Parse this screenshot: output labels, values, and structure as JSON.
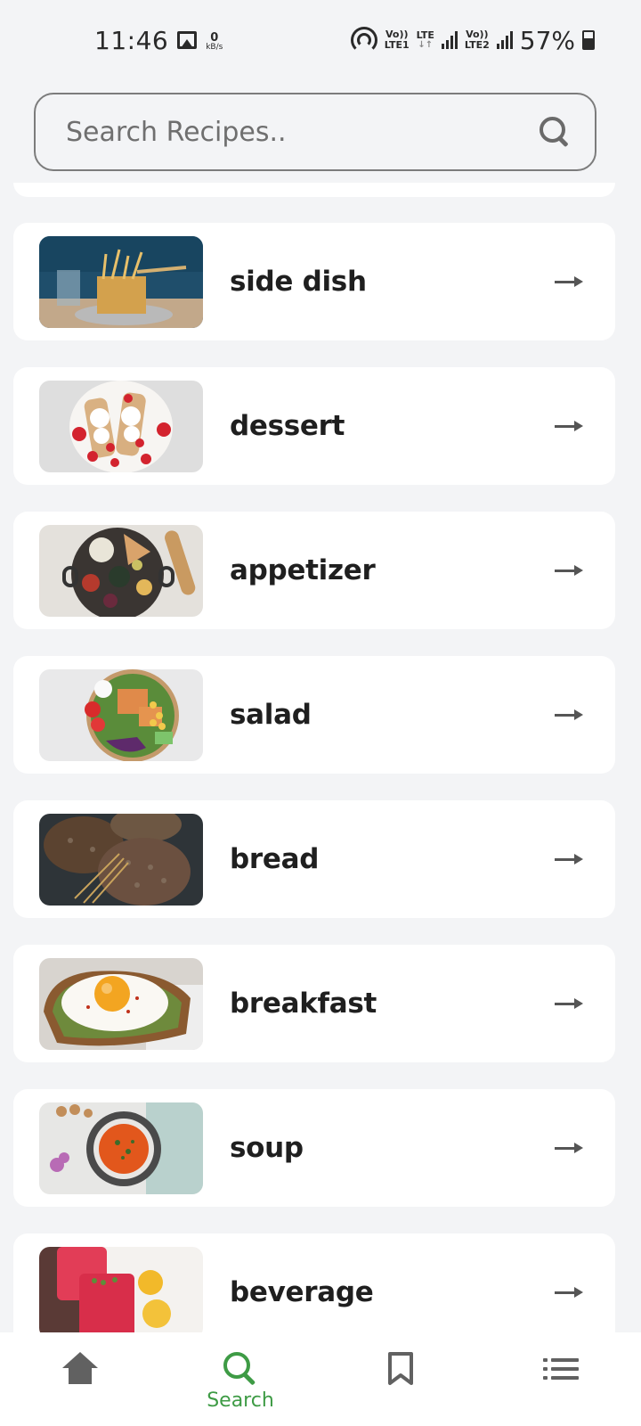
{
  "status_bar": {
    "time": "11:46",
    "speed_value": "0",
    "speed_unit": "kB/s",
    "net1_top": "Vo))",
    "net1_bottom": "LTE1",
    "net_lte": "LTE",
    "net2_top": "Vo))",
    "net2_bottom": "LTE2",
    "battery": "57%"
  },
  "search": {
    "placeholder": "Search Recipes..",
    "value": ""
  },
  "categories": [
    {
      "label": "side dish"
    },
    {
      "label": "dessert"
    },
    {
      "label": "appetizer"
    },
    {
      "label": "salad"
    },
    {
      "label": "bread"
    },
    {
      "label": "breakfast"
    },
    {
      "label": "soup"
    },
    {
      "label": "beverage"
    }
  ],
  "bottom_nav": {
    "active": "search",
    "search_label": "Search",
    "items": [
      "home-icon",
      "search-icon",
      "bookmark-icon",
      "list-icon"
    ]
  },
  "colors": {
    "accent": "#3e9b45",
    "background": "#f3f4f6",
    "card": "#ffffff"
  }
}
